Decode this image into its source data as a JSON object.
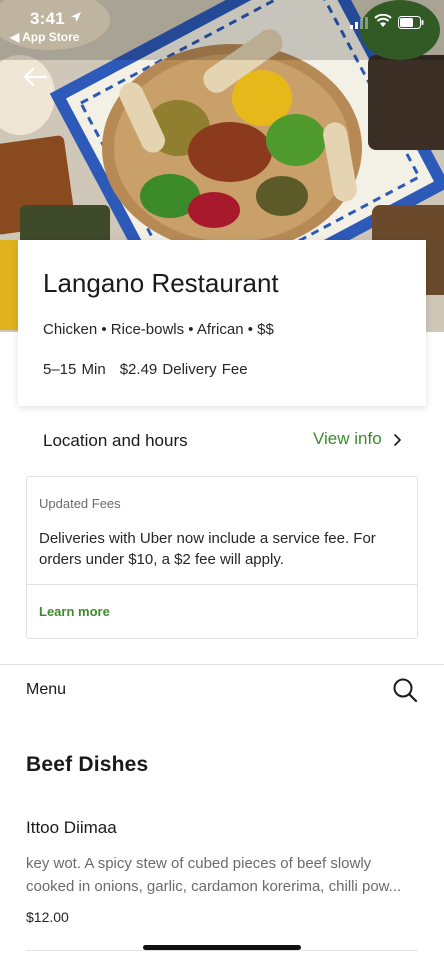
{
  "status_bar": {
    "time": "3:41",
    "back_app": "◀ App Store"
  },
  "restaurant": {
    "name": "Langano Restaurant",
    "cuisine": "Chicken • Rice-bowls • African • $$",
    "eta": "5–15 Min",
    "delivery_fee": "$2.49 Delivery Fee"
  },
  "location_row": {
    "label": "Location and hours",
    "link": "View info"
  },
  "fees_notice": {
    "title": "Updated Fees",
    "text": "Deliveries with Uber now include a service fee. For orders under $10, a $2 fee will apply.",
    "link": "Learn more"
  },
  "menu": {
    "label": "Menu",
    "sections": [
      {
        "heading": "Beef Dishes",
        "items": [
          {
            "name": "Ittoo Diimaa",
            "description": " key wot. A spicy stew of cubed pieces of beef slowly cooked in onions, garlic, cardamon korerima, chilli pow...",
            "price": "$12.00"
          }
        ]
      }
    ]
  },
  "colors": {
    "accent_green": "#3e8c2d",
    "text_primary": "#1a1a1a",
    "text_secondary": "#6b6b6b",
    "divider": "#e2e2e2"
  },
  "icons": {
    "back": "arrow-left-icon",
    "view_info": "chevron-right-icon",
    "search": "search-icon",
    "location": "location-arrow-icon"
  }
}
